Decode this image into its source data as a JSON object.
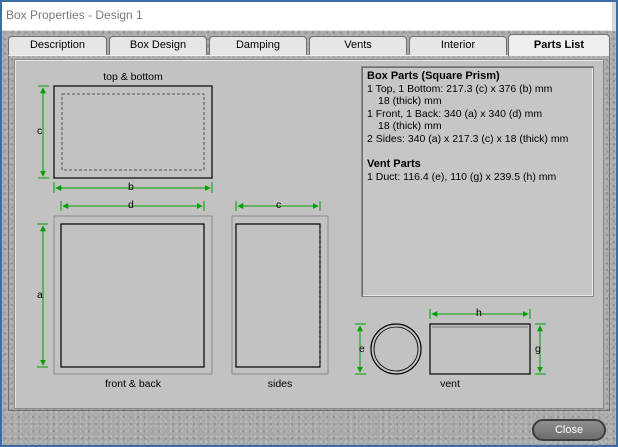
{
  "window": {
    "title": "Box Properties - Design 1"
  },
  "tabs": [
    {
      "label": "Description",
      "active": false
    },
    {
      "label": "Box Design",
      "active": false
    },
    {
      "label": "Damping",
      "active": false
    },
    {
      "label": "Vents",
      "active": false
    },
    {
      "label": "Interior",
      "active": false
    },
    {
      "label": "Parts List",
      "active": true
    }
  ],
  "diagram": {
    "top_bottom_label": "top & bottom",
    "front_back_label": "front & back",
    "sides_label": "sides",
    "vent_label": "vent",
    "dim_a": "a",
    "dim_b": "b",
    "dim_c": "c",
    "dim_d": "d",
    "dim_e": "e",
    "dim_g": "g",
    "dim_h": "h",
    "dimension_color": "#00a000"
  },
  "parts_list": {
    "box_heading": "Box Parts (Square Prism)",
    "box_line1": "1 Top, 1 Bottom:  217.3 (c) x 376 (b) mm",
    "box_line1b": "18 (thick) mm",
    "box_line2": "1 Front, 1 Back:  340 (a) x 340 (d) mm",
    "box_line2b": "18 (thick) mm",
    "box_line3": "2 Sides:  340 (a) x 217.3 (c) x 18 (thick) mm",
    "vent_heading": "Vent Parts",
    "vent_line1": "1 Duct:  116.4 (e), 110 (g) x 239.5 (h) mm"
  },
  "footer": {
    "close_label": "Close"
  }
}
